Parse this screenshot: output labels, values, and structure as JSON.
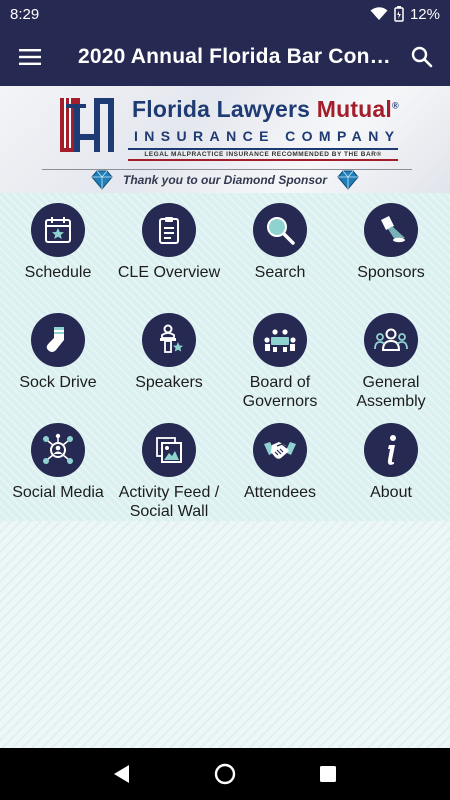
{
  "status": {
    "time": "8:29",
    "battery": "12%"
  },
  "appbar": {
    "title": "2020  Annual Florida Bar Con…"
  },
  "sponsor": {
    "brand_part1": "Florida Lawyers ",
    "brand_part2": "Mutual",
    "registered": "®",
    "subtitle": "INSURANCE COMPANY",
    "tagline": "LEGAL MALPRACTICE INSURANCE RECOMMENDED BY THE BAR®",
    "thanks": "Thank you to our Diamond Sponsor"
  },
  "tiles": [
    {
      "label": "Schedule",
      "icon": "calendar-star-icon"
    },
    {
      "label": "CLE Overview",
      "icon": "clipboard-icon"
    },
    {
      "label": "Search",
      "icon": "magnifier-icon"
    },
    {
      "label": "Sponsors",
      "icon": "spotlight-icon"
    },
    {
      "label": "Sock Drive",
      "icon": "sock-icon"
    },
    {
      "label": "Speakers",
      "icon": "podium-speaker-icon"
    },
    {
      "label": "Board of Governors",
      "icon": "boardroom-icon"
    },
    {
      "label": "General Assembly",
      "icon": "group-icon"
    },
    {
      "label": "Social Media",
      "icon": "network-icon"
    },
    {
      "label": "Activity Feed / Social Wall",
      "icon": "photo-gallery-icon"
    },
    {
      "label": "Attendees",
      "icon": "handshake-icon"
    },
    {
      "label": "About",
      "icon": "info-icon"
    }
  ],
  "colors": {
    "primary": "#262951",
    "brand_blue": "#1f3b73",
    "brand_red": "#a31d2b",
    "grid_bg": "#dbf0f0"
  }
}
